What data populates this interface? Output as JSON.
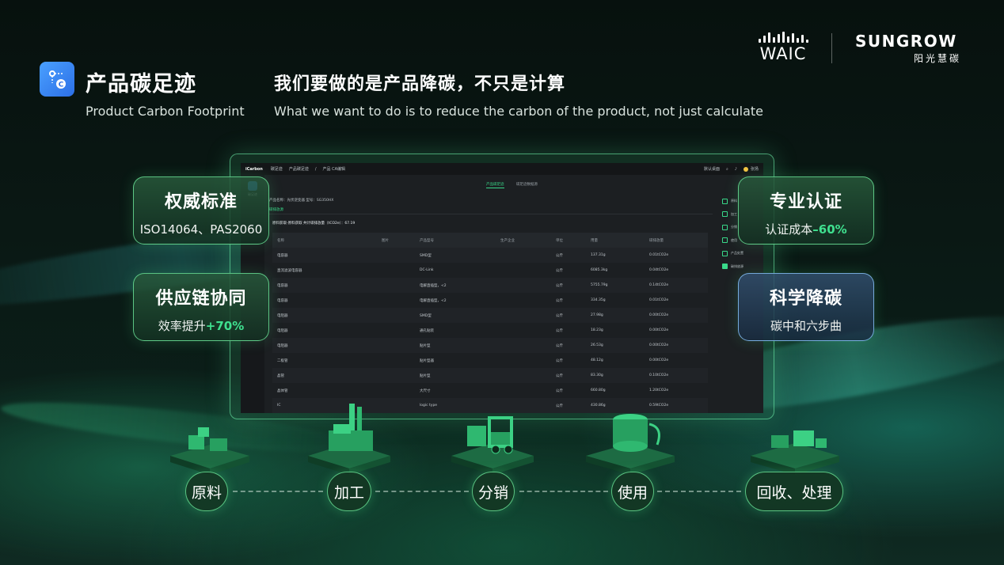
{
  "header": {
    "title_cn": "产品碳足迹",
    "title_en": "Product Carbon Footprint",
    "subtitle_cn": "我们要做的是产品降碳，不只是计算",
    "subtitle_en": "What we want to do is to reduce the carbon of the product, not just calculate"
  },
  "brands": {
    "waic": "WAIC",
    "sungrow": "SUNGROW",
    "sungrow_sub": "阳光慧碳"
  },
  "app": {
    "brand": "iCarbon",
    "crumbs": [
      "碳足迹",
      "产品碳足迹",
      "/",
      "产品 CA编辑"
    ],
    "topbar_right": "默认桌面",
    "user": "张扬",
    "side_label": "碳足迹",
    "tabs": [
      "产品碳足迹",
      "碳足迹数据源"
    ],
    "product_line": "产品名称：光伏逆变器  型号：SG350HX",
    "section_tab": "碳排放源",
    "stage_line": "原料获取-原料获取 共计碳排放量（tCO2e）：67.19",
    "columns": [
      "名称",
      "图片",
      "产品型号",
      "生产企业",
      "单位",
      "用量",
      "碳排放量"
    ],
    "rows": [
      [
        "电容器",
        "",
        "SMD型",
        "",
        "公斤",
        "137.31g",
        "0.01tCO2e"
      ],
      [
        "直流滤波电容器",
        "",
        "DC-Link",
        "",
        "公斤",
        "6085.3kg",
        "0.04tCO2e"
      ],
      [
        "电容器",
        "",
        "电解直插型，<2",
        "",
        "公斤",
        "5755.79g",
        "0.14tCO2e"
      ],
      [
        "电容器",
        "",
        "电解直插型，<2",
        "",
        "公斤",
        "334.35g",
        "0.01tCO2e"
      ],
      [
        "电阻器",
        "",
        "SMD型",
        "",
        "公斤",
        "27.98g",
        "0.00tCO2e"
      ],
      [
        "电阻器",
        "",
        "通孔贴装",
        "",
        "公斤",
        "18.23g",
        "0.00tCO2e"
      ],
      [
        "电阻器",
        "",
        "贴片型",
        "",
        "公斤",
        "26.53g",
        "0.00tCO2e"
      ],
      [
        "二极管",
        "",
        "贴片型器",
        "",
        "公斤",
        "48.12g",
        "0.00tCO2e"
      ],
      [
        "晶管",
        "",
        "贴片型",
        "",
        "公斤",
        "83.30g",
        "0.10tCO2e"
      ],
      [
        "晶体管",
        "",
        "大尺寸",
        "",
        "公斤",
        "660.80g",
        "1.20tCO2e"
      ],
      [
        "IC",
        "",
        "logic type",
        "",
        "公斤",
        "430.86g",
        "0.59tCO2e"
      ]
    ],
    "steps": [
      "原料",
      "加工",
      "分销",
      "使用",
      "产品处置",
      "碳排放源"
    ]
  },
  "cards": {
    "authority": {
      "title": "权威标准",
      "text": "ISO14064、PAS2060"
    },
    "supply": {
      "title": "供应链协同",
      "text_prefix": "效率提升",
      "highlight": "+70%"
    },
    "cert": {
      "title": "专业认证",
      "text_prefix": "认证成本",
      "highlight": "–60%"
    },
    "science": {
      "title": "科学降碳",
      "text": "碳中和六步曲"
    }
  },
  "process": [
    "原料",
    "加工",
    "分销",
    "使用",
    "回收、处理"
  ],
  "colors": {
    "accent_green": "#3fe08f",
    "app_bg": "#1c1f22",
    "logo_blue": "#3a8cff"
  }
}
